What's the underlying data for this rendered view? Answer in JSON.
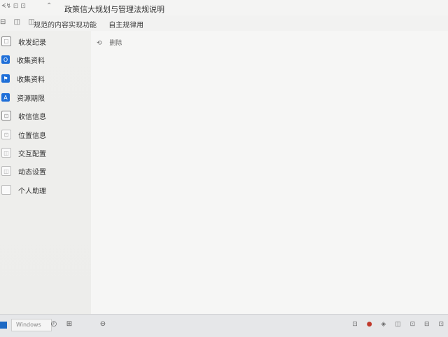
{
  "titlebar": {
    "left_text": "ᗕ↯ ⊡ ⊡",
    "back_icon": "⌃",
    "title": "政策信大规划与管理法规说明"
  },
  "breadcrumb": {
    "icons": [
      "⊟",
      "◫",
      "◫",
      "◫"
    ],
    "items": [
      "规范的内容实现功能",
      "自主规律用"
    ]
  },
  "sidebar": {
    "items": [
      {
        "label": "收发纪录",
        "icon": "☐",
        "style": "icon-gray-outline"
      },
      {
        "label": "收集资料",
        "icon": "O",
        "style": "icon-blue"
      },
      {
        "label": "收集资料",
        "icon": "⚑",
        "style": "icon-blue"
      },
      {
        "label": "资源期限",
        "icon": "A",
        "style": "icon-blue"
      },
      {
        "label": "收信信息",
        "icon": "⊡",
        "style": "icon-gray-outline"
      },
      {
        "label": "位置信息",
        "icon": "⊡",
        "style": "icon-light-outline"
      },
      {
        "label": "交互配置",
        "icon": "◫",
        "style": "icon-light-outline"
      },
      {
        "label": "动态设置",
        "icon": "◫",
        "style": "icon-light-outline"
      },
      {
        "label": "个人助理",
        "icon": "",
        "style": "icon-light-outline"
      }
    ]
  },
  "content": {
    "toolbar_icon": "⟲",
    "toolbar_label": "删除"
  },
  "taskbar": {
    "search_placeholder": "Windows",
    "icons": [
      "◴",
      "⊞",
      "⊖"
    ],
    "tray": [
      "⊡",
      "●",
      "◈",
      "◫",
      "⊡",
      "⊟",
      "⊡"
    ]
  }
}
